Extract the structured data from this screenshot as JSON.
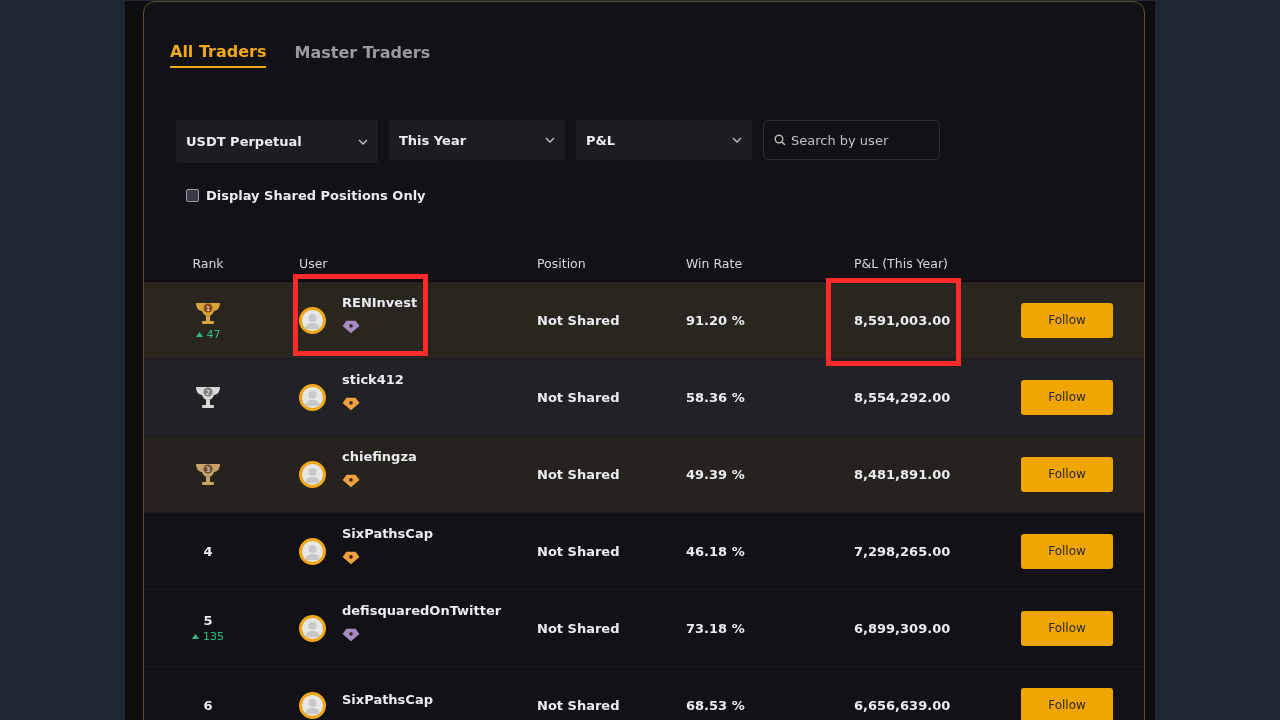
{
  "tabs": [
    {
      "label": "All Traders",
      "selected": true
    },
    {
      "label": "Master Traders",
      "selected": false
    }
  ],
  "filters": [
    {
      "value": "USDT Perpetual"
    },
    {
      "value": "This Year"
    },
    {
      "value": "P&L"
    }
  ],
  "search": {
    "placeholder": "Search by user"
  },
  "shared_only": {
    "label": "Display Shared Positions Only",
    "checked": false
  },
  "columns": [
    "Rank",
    "User",
    "Position",
    "Win Rate",
    "P&L (This Year)"
  ],
  "rows": [
    {
      "rank": "1",
      "kind": "gold",
      "change": "47",
      "user": "RENInvest",
      "badge": {
        "color": "#a58bc4"
      },
      "position": "Not Shared",
      "win_rate": "91.20 %",
      "pnl": "8,591,003.00",
      "button": "Follow",
      "user_marked": true,
      "pnl_marked": true
    },
    {
      "rank": "2",
      "kind": "silver",
      "user": "stick412",
      "badge": {
        "color": "#f0a040"
      },
      "position": "Not Shared",
      "win_rate": "58.36 %",
      "pnl": "8,554,292.00",
      "button": "Follow",
      "user_marked": false,
      "pnl_marked": false
    },
    {
      "rank": "3",
      "kind": "bronze",
      "user": "chiefingza",
      "badge": {
        "color": "#f0a040"
      },
      "position": "Not Shared",
      "win_rate": "49.39 %",
      "pnl": "8,481,891.00",
      "button": "Follow",
      "user_marked": false,
      "pnl_marked": false
    },
    {
      "rank": "4",
      "kind": "plain",
      "user": "SixPathsCap",
      "badge": {
        "color": "#f0a040"
      },
      "position": "Not Shared",
      "win_rate": "46.18 %",
      "pnl": "7,298,265.00",
      "button": "Follow",
      "user_marked": false,
      "pnl_marked": false
    },
    {
      "rank": "5",
      "kind": "plain",
      "change": "135",
      "user": "defisquaredOnTwitter",
      "badge": {
        "color": "#a58bc4"
      },
      "position": "Not Shared",
      "win_rate": "73.18 %",
      "pnl": "6,899,309.00",
      "button": "Follow",
      "user_marked": false,
      "pnl_marked": false
    },
    {
      "rank": "6",
      "kind": "plain",
      "user": "SixPathsCap",
      "position": "Not Shared",
      "win_rate": "68.53 %",
      "pnl": "6,656,639.00",
      "button": "Follow",
      "user_marked": false,
      "pnl_marked": false
    }
  ]
}
